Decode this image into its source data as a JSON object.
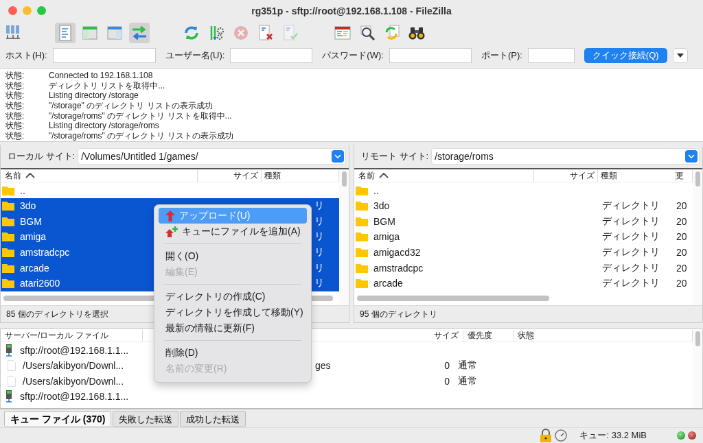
{
  "window": {
    "title": "rg351p - sftp://root@192.168.1.108 - FileZilla"
  },
  "toolbar": [
    {
      "pressed": false,
      "disabled": false
    },
    {
      "pressed": true,
      "disabled": false
    },
    {
      "pressed": false,
      "disabled": false
    },
    {
      "pressed": false,
      "disabled": false
    },
    {
      "pressed": true,
      "disabled": false
    },
    {
      "pressed": false,
      "disabled": false
    },
    {
      "pressed": false,
      "disabled": false
    },
    {
      "pressed": false,
      "disabled": true
    },
    {
      "pressed": false,
      "disabled": false
    },
    {
      "pressed": false,
      "disabled": true
    },
    {
      "pressed": false,
      "disabled": false
    },
    {
      "pressed": false,
      "disabled": false
    },
    {
      "pressed": false,
      "disabled": false
    },
    {
      "pressed": false,
      "disabled": false
    }
  ],
  "quickconnect": {
    "host_label": "ホスト(H):",
    "user_label": "ユーザー名(U):",
    "password_label": "パスワード(W):",
    "port_label": "ポート(P):",
    "connect_button": "クイック接続(Q)"
  },
  "message_log": [
    {
      "label": "状態:",
      "text": "Connected to 192.168.1.108"
    },
    {
      "label": "状態:",
      "text": "ディレクトリ リストを取得中..."
    },
    {
      "label": "状態:",
      "text": "Listing directory /storage"
    },
    {
      "label": "状態:",
      "text": "\"/storage\" のディレクトリ リストの表示成功"
    },
    {
      "label": "状態:",
      "text": "\"/storage/roms\" のディレクトリ リストを取得中..."
    },
    {
      "label": "状態:",
      "text": "Listing directory /storage/roms"
    },
    {
      "label": "状態:",
      "text": "\"/storage/roms\" のディレクトリ リストの表示成功"
    }
  ],
  "local": {
    "site_label": "ローカル サイト:",
    "path": "/Volumes/Untitled 1/games/",
    "columns": [
      "名前",
      "サイズ",
      "種類"
    ],
    "rows": [
      {
        "name": "..",
        "type": "",
        "selected": false
      },
      {
        "name": "3do",
        "type": "リ",
        "selected": true
      },
      {
        "name": "BGM",
        "type": "リ",
        "selected": true
      },
      {
        "name": "amiga",
        "type": "リ",
        "selected": true
      },
      {
        "name": "amstradcpc",
        "type": "リ",
        "selected": true
      },
      {
        "name": "arcade",
        "type": "リ",
        "selected": true
      },
      {
        "name": "atari2600",
        "type": "リ",
        "selected": true
      }
    ],
    "status": "85 個のディレクトリを選択"
  },
  "remote": {
    "site_label": "リモート サイト:",
    "path": "/storage/roms",
    "columns": [
      "名前",
      "サイズ",
      "種類",
      "更"
    ],
    "rows": [
      {
        "name": "..",
        "type": "",
        "date": "",
        "selected": false
      },
      {
        "name": "3do",
        "type": "ディレクトリ",
        "date": "20",
        "selected": false
      },
      {
        "name": "BGM",
        "type": "ディレクトリ",
        "date": "20",
        "selected": false
      },
      {
        "name": "amiga",
        "type": "ディレクトリ",
        "date": "20",
        "selected": false
      },
      {
        "name": "amigacd32",
        "type": "ディレクトリ",
        "date": "20",
        "selected": false
      },
      {
        "name": "amstradcpc",
        "type": "ディレクトリ",
        "date": "20",
        "selected": false
      },
      {
        "name": "arcade",
        "type": "ディレクトリ",
        "date": "20",
        "selected": false
      }
    ],
    "status": "95 個のディレクトリ"
  },
  "context_menu": [
    {
      "kind": "item",
      "label": "アップロード(U)",
      "selected": true,
      "disabled": false
    },
    {
      "kind": "item",
      "label": "キューにファイルを追加(A)",
      "selected": false,
      "disabled": false
    },
    {
      "kind": "separator"
    },
    {
      "kind": "item",
      "label": "開く(O)",
      "selected": false,
      "disabled": false
    },
    {
      "kind": "item",
      "label": "編集(E)",
      "selected": false,
      "disabled": true
    },
    {
      "kind": "separator"
    },
    {
      "kind": "item",
      "label": "ディレクトリの作成(C)",
      "selected": false,
      "disabled": false
    },
    {
      "kind": "item",
      "label": "ディレクトリを作成して移動(Y)",
      "selected": false,
      "disabled": false
    },
    {
      "kind": "item",
      "label": "最新の情報に更新(F)",
      "selected": false,
      "disabled": false
    },
    {
      "kind": "separator"
    },
    {
      "kind": "item",
      "label": "削除(D)",
      "selected": false,
      "disabled": false
    },
    {
      "kind": "item",
      "label": "名前の変更(R)",
      "selected": false,
      "disabled": true
    }
  ],
  "queue": {
    "columns": [
      "サーバー/ローカル ファイル",
      "サイズ",
      "優先度",
      "状態"
    ],
    "rows": [
      {
        "kind": "server",
        "file": "sftp://root@192.168.1.1...",
        "remote": "",
        "size": "",
        "priority": ""
      },
      {
        "kind": "file",
        "file": "/Users/akibyon/Downl...",
        "remote": "ges",
        "size": "0",
        "priority": "通常"
      },
      {
        "kind": "file",
        "file": "/Users/akibyon/Downl...",
        "remote": "",
        "size": "0",
        "priority": "通常"
      },
      {
        "kind": "server",
        "file": "sftp://root@192.168.1.1...",
        "remote": "",
        "size": "",
        "priority": ""
      }
    ]
  },
  "queue_tabs": [
    {
      "label": "キュー ファイル (370)",
      "selected": true
    },
    {
      "label": "失敗した転送",
      "selected": false
    },
    {
      "label": "成功した転送",
      "selected": false
    }
  ],
  "status_bar": {
    "queue": "キュー: 33.2 MiB"
  }
}
